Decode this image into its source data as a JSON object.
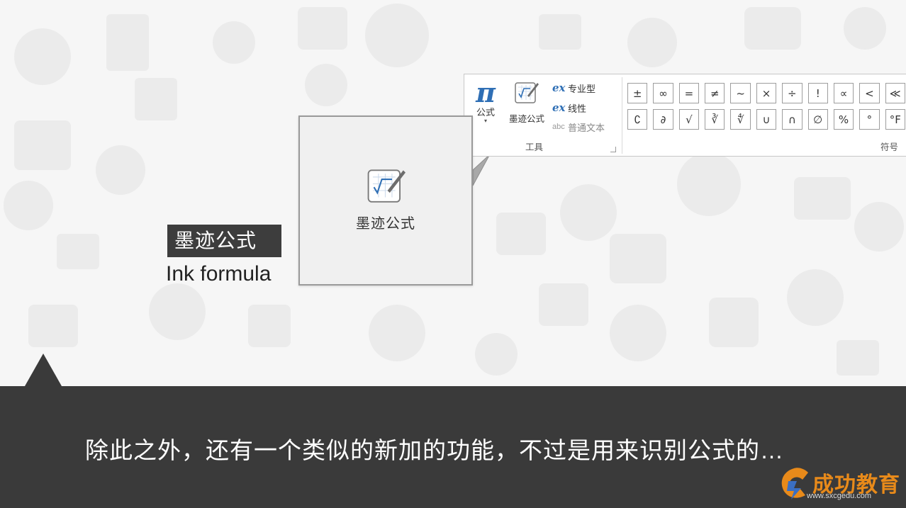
{
  "ribbon": {
    "tools_group": {
      "equation_button": {
        "glyph": "π",
        "label": "公式",
        "caret": "▾"
      },
      "ink_button": {
        "label": "墨迹公式"
      },
      "options": [
        {
          "icon": "ex",
          "label": "专业型"
        },
        {
          "icon": "ex",
          "label": "线性"
        },
        {
          "icon": "abc",
          "label": "普通文本"
        }
      ],
      "title": "工具"
    },
    "symbols_group": {
      "row1": [
        "±",
        "∞",
        "=",
        "≠",
        "~",
        "×",
        "÷",
        "!",
        "∝",
        "<",
        "≪"
      ],
      "row2": [
        "∁",
        "∂",
        "√",
        "∛",
        "∜",
        "∪",
        "∩",
        "∅",
        "%",
        "°",
        "°F"
      ],
      "title": "符号"
    }
  },
  "callout": {
    "label": "墨迹公式"
  },
  "captions": {
    "chinese": "墨迹公式",
    "english": "Ink formula"
  },
  "bottom": {
    "subtitle": "除此之外，还有一个类似的新加的功能，不过是用来识别公式的…",
    "logo_text": "成功教育",
    "logo_url": "www.sxcgedu.com"
  },
  "colors": {
    "accent_blue": "#2f6fb5",
    "bar": "#3a3a3a",
    "logo_orange": "#e88a1a"
  }
}
